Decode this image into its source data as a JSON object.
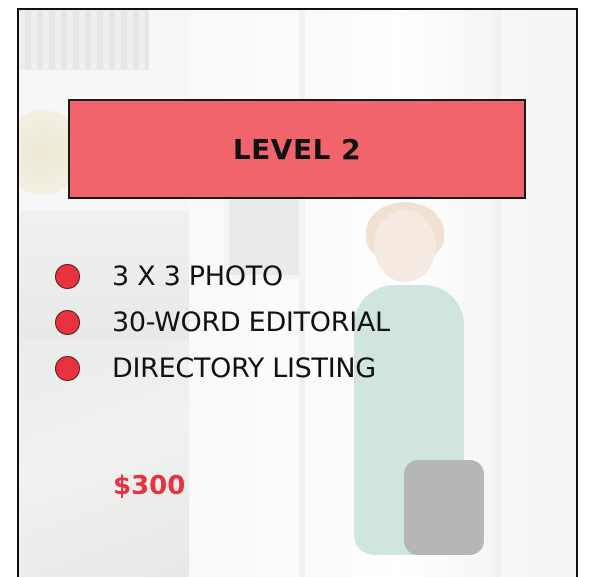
{
  "card": {
    "title": "LEVEL 2",
    "features": [
      {
        "label": "3 X 3 PHOTO"
      },
      {
        "label": "30-WORD EDITORIAL"
      },
      {
        "label": "DIRECTORY LISTING"
      }
    ],
    "price": "$300"
  },
  "colors": {
    "banner": "#f2646c",
    "bullet": "#e8323f",
    "price": "#e8323f",
    "border": "#111111"
  },
  "background": {
    "image": "faded photo of a child holding a bag beside a white building"
  }
}
